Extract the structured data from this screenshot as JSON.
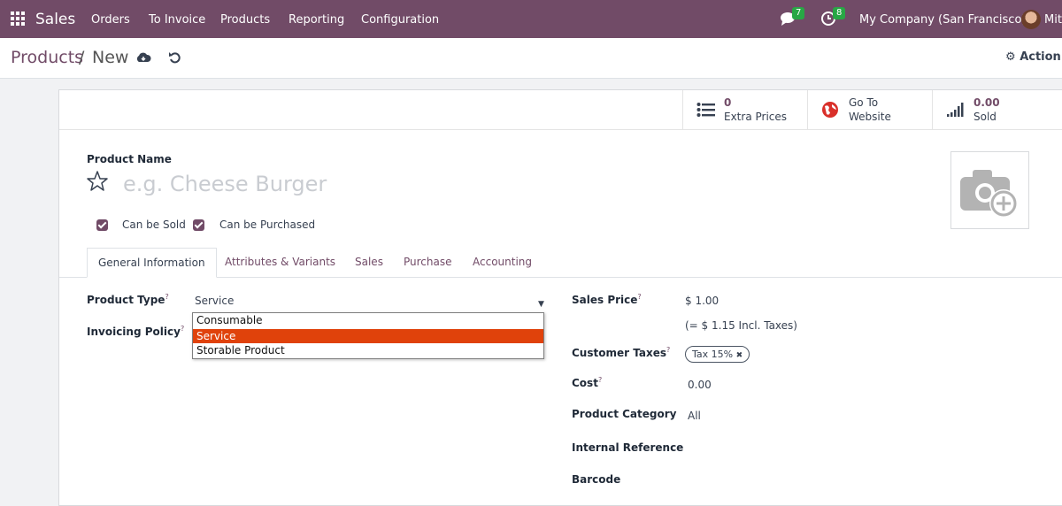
{
  "navbar": {
    "app_name": "Sales",
    "menu": [
      "Orders",
      "To Invoice",
      "Products",
      "Reporting",
      "Configuration"
    ],
    "messages_count": "7",
    "activities_count": "8",
    "company": "My Company (San Francisco)",
    "user": "Mit"
  },
  "breadcrumb": {
    "parent": "Products",
    "separator": "/",
    "current": "New"
  },
  "control": {
    "action_label": "Action"
  },
  "stat_buttons": {
    "extra_prices": {
      "value": "0",
      "label": "Extra Prices"
    },
    "website": {
      "line1": "Go To",
      "line2": "Website"
    },
    "sold": {
      "value": "0.00",
      "label": "Sold"
    }
  },
  "form": {
    "name_label": "Product Name",
    "name_placeholder": "e.g. Cheese Burger",
    "can_be_sold": "Can be Sold",
    "can_be_purchased": "Can be Purchased",
    "tabs": [
      "General Information",
      "Attributes & Variants",
      "Sales",
      "Purchase",
      "Accounting"
    ],
    "product_type_label": "Product Type",
    "product_type_value": "Service",
    "product_type_options": [
      "Consumable",
      "Service",
      "Storable Product"
    ],
    "invoicing_policy_label": "Invoicing Policy",
    "help_marker": "?",
    "sales_price_label": "Sales Price",
    "sales_price_value": "$ 1.00",
    "sales_price_incl": "(= $ 1.15 Incl. Taxes)",
    "customer_taxes_label": "Customer Taxes",
    "customer_tax_tag": "Tax 15%",
    "tag_remove": "✖",
    "cost_label": "Cost",
    "cost_value": "0.00",
    "category_label": "Product Category",
    "category_value": "All",
    "internal_ref_label": "Internal Reference",
    "barcode_label": "Barcode"
  },
  "colors": {
    "brand": "#714b67",
    "badge": "#28a745",
    "selected_option": "#e0420b"
  }
}
